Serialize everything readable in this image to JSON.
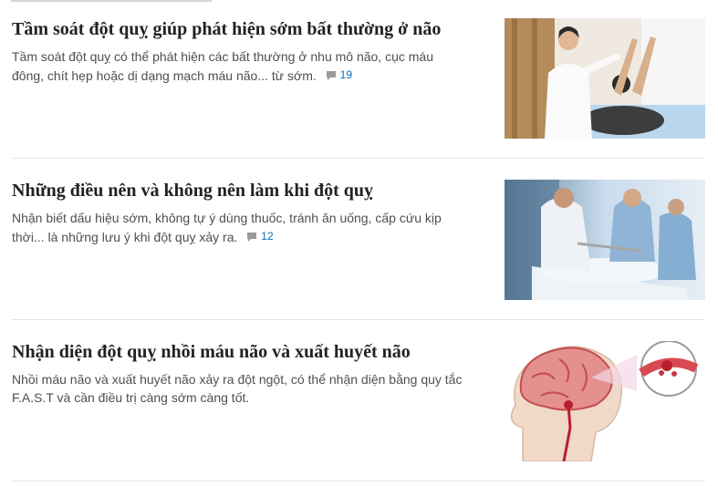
{
  "articles": [
    {
      "title": "Tầm soát đột quỵ giúp phát hiện sớm bất thường ở não",
      "description": "Tầm soát đột quỵ có thể phát hiện các bất thường ở nhu mô não, cục máu đông, chít hẹp hoặc dị dạng mạch máu não... từ sớm.",
      "comments": "19",
      "image": "doctor-patient-mri-photo"
    },
    {
      "title": "Những điều nên và không nên làm khi đột quỵ",
      "description": "Nhận biết dấu hiệu sớm, không tự ý dùng thuốc, tránh ăn uống, cấp cứu kịp thời... là những lưu ý khi đột quỵ xảy ra.",
      "comments": "12",
      "image": "emergency-stretcher-photo"
    },
    {
      "title": "Nhận diện đột quỵ nhồi máu não và xuất huyết não",
      "description": "Nhồi máu não và xuất huyết não xảy ra đột ngột, có thể nhận diện bằng quy tắc F.A.S.T và cần điều trị càng sớm càng tốt.",
      "image": "brain-hemorrhage-illustration"
    }
  ],
  "colors": {
    "title": "#222222",
    "description": "#4f4f4f",
    "comment_count": "#076db6",
    "divider": "#e5e5e5"
  }
}
